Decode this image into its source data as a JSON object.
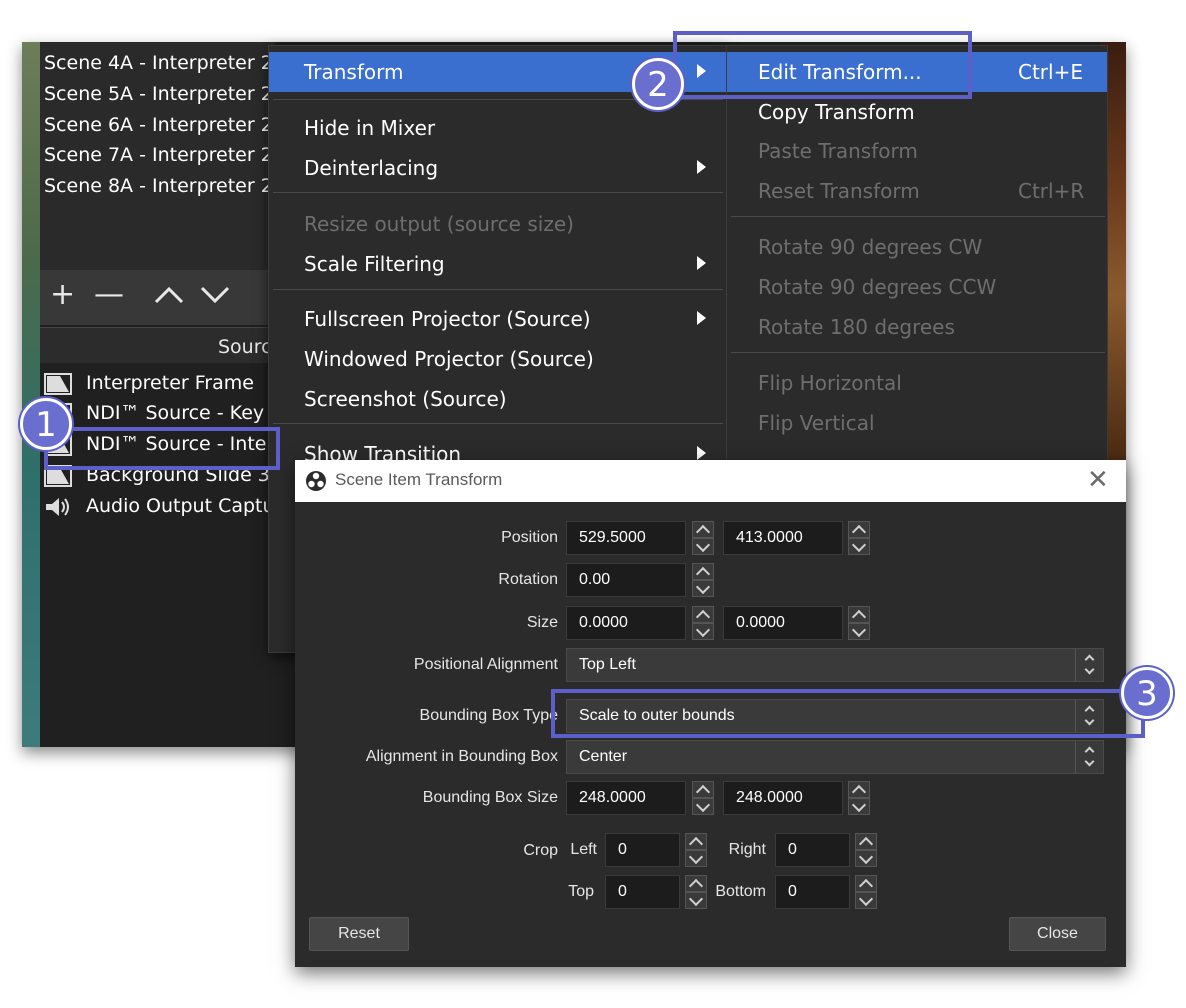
{
  "scenes": [
    "Scene 4A - Interpreter 2",
    "Scene 5A - Interpreter 2",
    "Scene 6A - Interpreter 2",
    "Scene 7A - Interpreter 2",
    "Scene 8A - Interpreter 2"
  ],
  "scene_toolbar": {
    "add": "+",
    "remove": "—",
    "up": "^",
    "down": "v"
  },
  "sources_header": "Sourc",
  "sources": [
    {
      "label": "Interpreter Frame",
      "icon": "image-icon"
    },
    {
      "label": "NDI™ Source - Key M",
      "icon": "image-icon"
    },
    {
      "label": "NDI™ Source - Interp",
      "icon": "image-icon"
    },
    {
      "label": "Background Slide 3",
      "icon": "image-icon"
    },
    {
      "label": "Audio Output Captur",
      "icon": "speaker-icon"
    }
  ],
  "context_menu": {
    "transform": "Transform",
    "hide_in_mixer": "Hide in Mixer",
    "deinterlacing": "Deinterlacing",
    "resize_output": "Resize output (source size)",
    "scale_filtering": "Scale Filtering",
    "fullscreen_projector": "Fullscreen Projector (Source)",
    "windowed_projector": "Windowed Projector (Source)",
    "screenshot": "Screenshot (Source)",
    "show_transition": "Show Transition"
  },
  "transform_submenu": {
    "edit_transform": "Edit Transform...",
    "edit_transform_shortcut": "Ctrl+E",
    "copy_transform": "Copy Transform",
    "paste_transform": "Paste Transform",
    "reset_transform": "Reset Transform",
    "reset_transform_shortcut": "Ctrl+R",
    "rotate_cw": "Rotate 90 degrees CW",
    "rotate_ccw": "Rotate 90 degrees CCW",
    "rotate_180": "Rotate 180 degrees",
    "flip_horizontal": "Flip Horizontal",
    "flip_vertical": "Flip Vertical"
  },
  "dialog": {
    "title": "Scene Item Transform",
    "close_glyph": "✕",
    "position_label": "Position",
    "position_x": "529.5000",
    "position_y": "413.0000",
    "rotation_label": "Rotation",
    "rotation": "0.00",
    "size_label": "Size",
    "size_w": "0.0000",
    "size_h": "0.0000",
    "positional_alignment_label": "Positional Alignment",
    "positional_alignment": "Top Left",
    "bounding_box_type_label": "Bounding Box Type",
    "bounding_box_type": "Scale to outer bounds",
    "alignment_in_bbox_label": "Alignment in Bounding Box",
    "alignment_in_bbox": "Center",
    "bbox_size_label": "Bounding Box Size",
    "bbox_w": "248.0000",
    "bbox_h": "248.0000",
    "crop_label": "Crop",
    "crop_left_label": "Left",
    "crop_left": "0",
    "crop_right_label": "Right",
    "crop_right": "0",
    "crop_top_label": "Top",
    "crop_top": "0",
    "crop_bottom_label": "Bottom",
    "crop_bottom": "0",
    "reset": "Reset",
    "close": "Close"
  },
  "callouts": {
    "one": "1",
    "two": "2",
    "three": "3"
  },
  "colors": {
    "highlight": "#3b6fcf",
    "callout": "#5b5fc7"
  }
}
